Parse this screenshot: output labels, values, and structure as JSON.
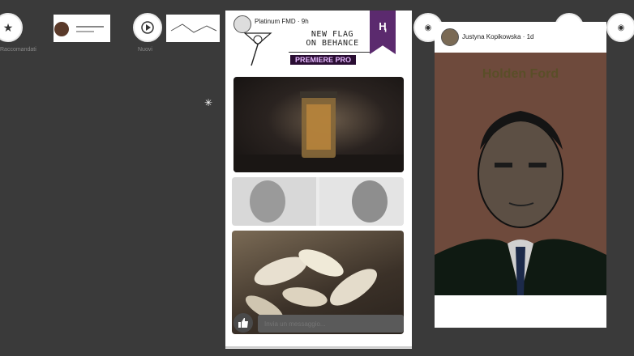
{
  "stories": {
    "item1_label": "Raccomandati",
    "item1_icon": "star-icon",
    "item2_label": "Nuovi",
    "item2_icon": "play-icon"
  },
  "center_card": {
    "username": "Platinum FMD · 9h",
    "title_line1": "NEW FLAG",
    "title_line2": "ON BEHANCE",
    "badge": "PREMIERE PRO",
    "reply_placeholder": "Invia un messaggio...",
    "bookmark_icon": "bookmark-icon",
    "like_icon": "thumbs-up-icon"
  },
  "right_card": {
    "username": "Justyna Kopikowska · 1d",
    "poster_title": "Holden Ford"
  },
  "colors": {
    "background": "#3a3a3a",
    "badge": "#2a0e33",
    "bookmark": "#5b2a6e",
    "poster": "#6e4a3c"
  }
}
